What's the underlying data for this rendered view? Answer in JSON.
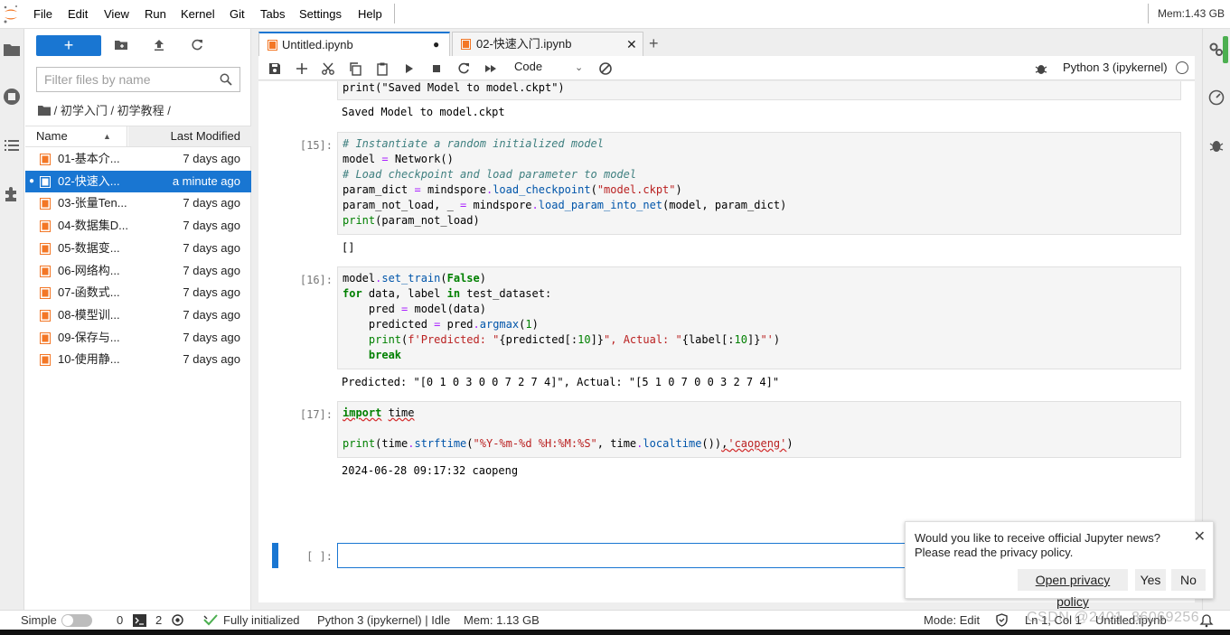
{
  "menu": {
    "items": [
      "File",
      "Edit",
      "View",
      "Run",
      "Kernel",
      "Git",
      "Tabs",
      "Settings",
      "Help"
    ],
    "memory": "Mem:1.43 GB"
  },
  "file_browser": {
    "new_button": "+",
    "filter_placeholder": "Filter files by name",
    "breadcrumb": "/ 初学入门 / 初学教程 /",
    "col_name": "Name",
    "col_modified": "Last Modified",
    "files": [
      {
        "name": "01-基本介...",
        "modified": "7 days ago"
      },
      {
        "name": "02-快速入...",
        "modified": "a minute ago"
      },
      {
        "name": "03-张量Ten...",
        "modified": "7 days ago"
      },
      {
        "name": "04-数据集D...",
        "modified": "7 days ago"
      },
      {
        "name": "05-数据变...",
        "modified": "7 days ago"
      },
      {
        "name": "06-网络构...",
        "modified": "7 days ago"
      },
      {
        "name": "07-函数式...",
        "modified": "7 days ago"
      },
      {
        "name": "08-模型训...",
        "modified": "7 days ago"
      },
      {
        "name": "09-保存与...",
        "modified": "7 days ago"
      },
      {
        "name": "10-使用静...",
        "modified": "7 days ago"
      }
    ]
  },
  "tabs": [
    {
      "label": "Untitled.ipynb"
    },
    {
      "label": "02-快速入门.ipynb"
    }
  ],
  "toolbar": {
    "cell_type": "Code",
    "kernel": "Python 3 (ipykernel)"
  },
  "cells": {
    "c14_code_tail": "print(\"Saved Model to model.ckpt\")",
    "c14_output": "Saved Model to model.ckpt",
    "c15_prompt": "[15]:",
    "c15_output": "[]",
    "c16_prompt": "[16]:",
    "c16_output": "Predicted: \"[0 1 0 3 0 0 7 2 7 4]\", Actual: \"[5 1 0 7 0 0 3 2 7 4]\"",
    "c17_prompt": "[17]:",
    "c17_output": "2024-06-28 09:17:32 caopeng",
    "empty_prompt": "[ ]:"
  },
  "status": {
    "mode_label": "Simple",
    "terminals": "0",
    "kernels": "2",
    "initialized": "Fully initialized",
    "kernel_state": "Python 3 (ipykernel) | Idle",
    "memory": "Mem: 1.13 GB",
    "edit_mode": "Mode: Edit",
    "position": "Ln 1, Col 1",
    "file": "Untitled.ipynb"
  },
  "notification": {
    "line1": "Would you like to receive official Jupyter news?",
    "line2": "Please read the privacy policy.",
    "open_policy": "Open privacy policy",
    "yes": "Yes",
    "no": "No"
  },
  "watermark": "CSDN @2401_86069256",
  "colors": {
    "accent": "#1976d2",
    "notebook_icon": "#f37726"
  }
}
